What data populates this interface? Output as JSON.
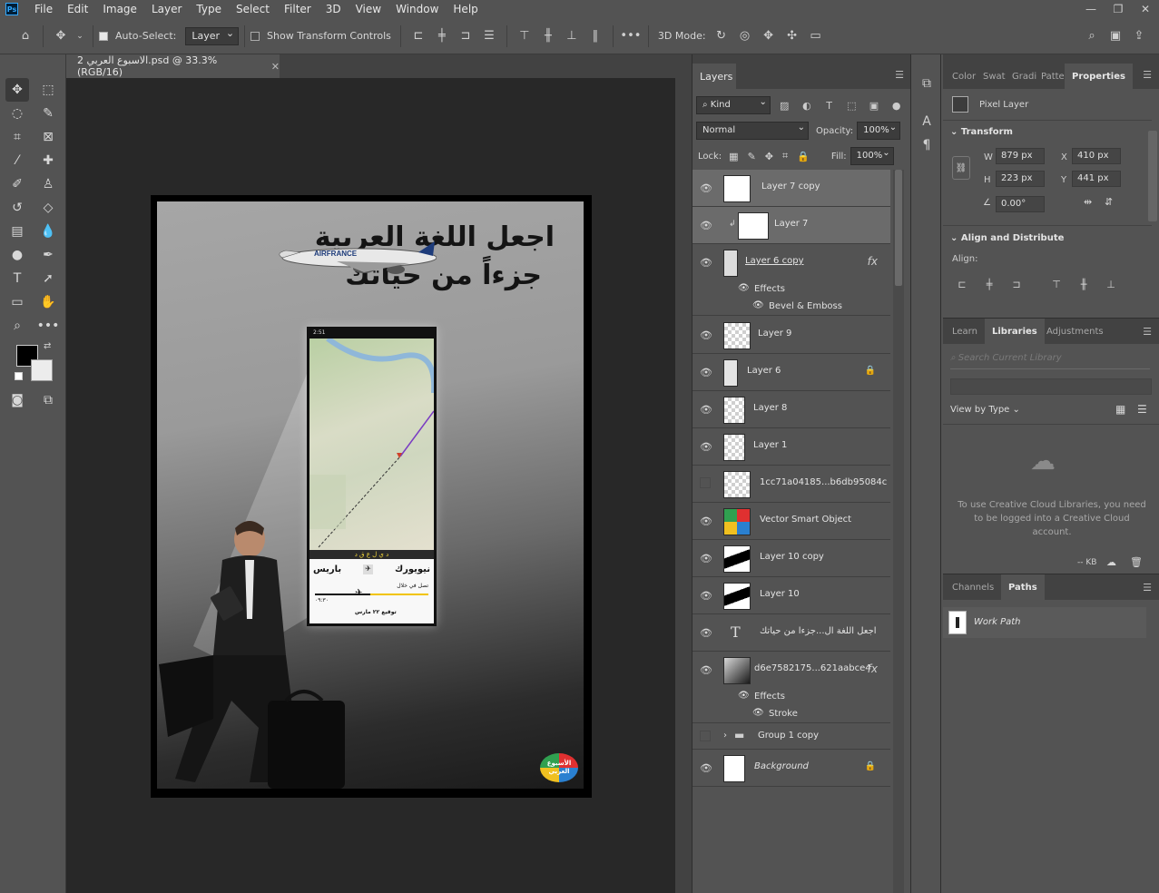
{
  "menu": [
    "File",
    "Edit",
    "Image",
    "Layer",
    "Type",
    "Select",
    "Filter",
    "3D",
    "View",
    "Window",
    "Help"
  ],
  "app_logo": "Ps",
  "window_controls": [
    "—",
    "❐",
    "✕"
  ],
  "options": {
    "auto_select_label": "Auto-Select:",
    "auto_select_value": "Layer",
    "show_transform_label": "Show Transform Controls",
    "mode_3d_label": "3D Mode:"
  },
  "document": {
    "tab_title": "الاسبوع العربي 2.psd @ 33.3% (RGB/16)"
  },
  "poster": {
    "title_line1": "اجعل اللغة العربية",
    "title_line2": "جزءاً من حياتك",
    "phone_band": "د ي ل ع ق د",
    "city_from": "نيويورك",
    "city_to": "باريس",
    "flight_text": "تصل في خلال",
    "flight_time": "٠٩:٣٠",
    "date_text": "توقيع ٢٢ مارس",
    "badge_text": "الأسبوع العربي",
    "plane_label": "AIRFRANCE"
  },
  "layers_panel": {
    "tab": "Layers",
    "kind_filter": "Kind",
    "blend_mode": "Normal",
    "opacity_label": "Opacity:",
    "opacity_value": "100%",
    "lock_label": "Lock:",
    "fill_label": "Fill:",
    "fill_value": "100%",
    "layers": [
      {
        "name": "Layer 7 copy",
        "visible": true,
        "selected": true
      },
      {
        "name": "Layer 7",
        "visible": true,
        "selected": true
      },
      {
        "name": "Layer 6 copy",
        "visible": true,
        "fx": "fx"
      },
      {
        "name": "Effects"
      },
      {
        "name": "Bevel & Emboss"
      },
      {
        "name": "Layer 9",
        "visible": true
      },
      {
        "name": "Layer 6",
        "visible": true
      },
      {
        "name": "Layer 8",
        "visible": true
      },
      {
        "name": "Layer 1",
        "visible": true
      },
      {
        "name": "1cc71a04185...b6db95084c",
        "visible": false
      },
      {
        "name": "Vector Smart Object",
        "visible": true
      },
      {
        "name": "Layer 10 copy",
        "visible": true
      },
      {
        "name": "Layer 10",
        "visible": true
      },
      {
        "name": "اجعل اللغة ال...جزءا من حياتك",
        "visible": true
      },
      {
        "name": "d6e7582175...621aabce4",
        "visible": true,
        "fx": "fx"
      },
      {
        "name": "Effects"
      },
      {
        "name": "Stroke"
      },
      {
        "name": "Group 1 copy",
        "visible": false
      },
      {
        "name": "Background",
        "visible": true
      }
    ]
  },
  "properties_panel": {
    "tabs": [
      "Color",
      "Swat",
      "Gradi",
      "Patte",
      "Properties"
    ],
    "layer_type": "Pixel Layer",
    "transform_label": "Transform",
    "w_label": "W",
    "w_value": "879 px",
    "h_label": "H",
    "h_value": "223 px",
    "x_label": "X",
    "x_value": "410 px",
    "y_label": "Y",
    "y_value": "441 px",
    "angle_value": "0.00°",
    "align_section": "Align and Distribute",
    "align_label": "Align:"
  },
  "libraries_panel": {
    "tabs": [
      "Learn",
      "Libraries",
      "Adjustments"
    ],
    "search_placeholder": "Search Current Library",
    "view_by": "View by Type",
    "message": "To use Creative Cloud Libraries, you need to be logged into a Creative Cloud account.",
    "kb": "-- KB"
  },
  "paths_panel": {
    "tabs": [
      "Channels",
      "Paths"
    ],
    "path_name": "Work Path"
  }
}
